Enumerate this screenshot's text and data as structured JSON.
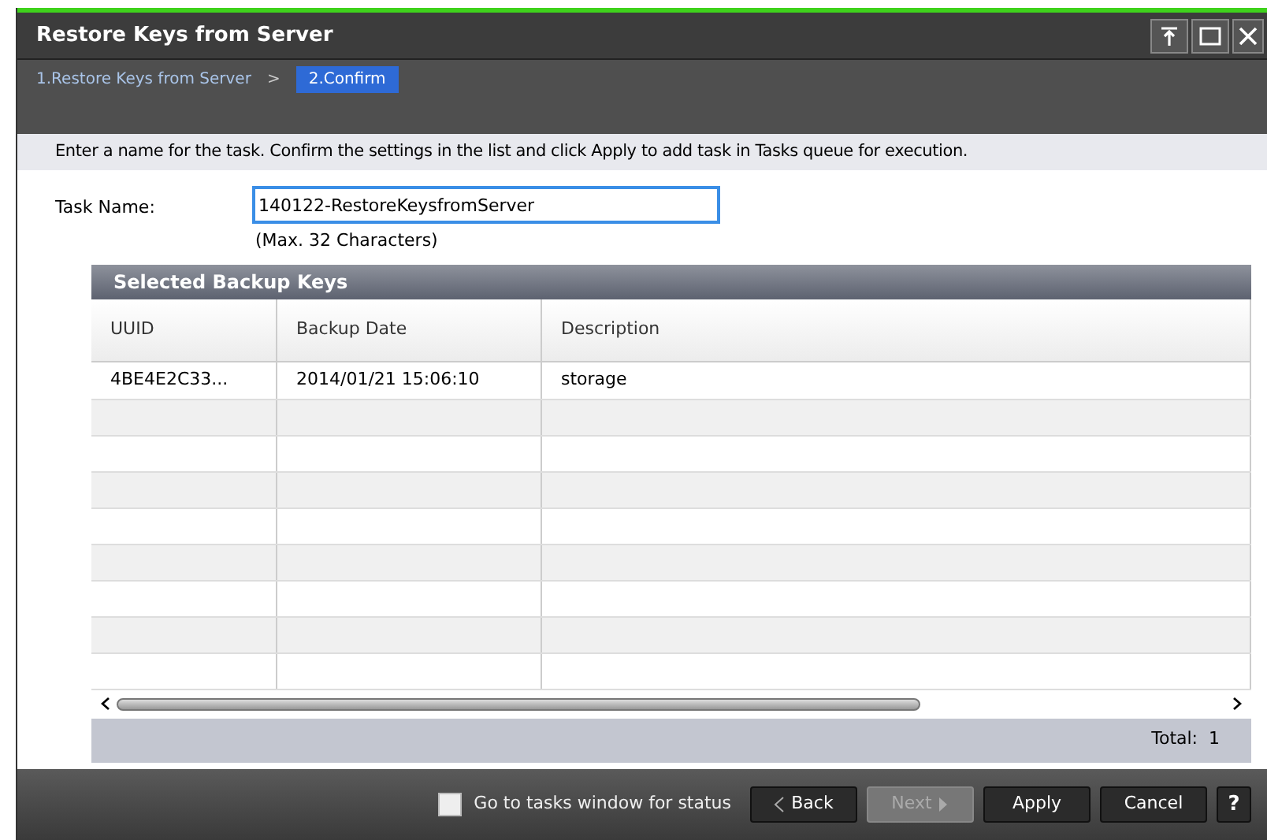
{
  "window": {
    "title": "Restore Keys from Server"
  },
  "steps": [
    {
      "label": "1.Restore Keys from Server",
      "selected": false
    },
    {
      "label": "2.Confirm",
      "selected": true
    }
  ],
  "step_separator": ">",
  "instruction": "Enter a name for the task. Confirm the settings in the list and click Apply to add task in Tasks queue for execution.",
  "task_name": {
    "label": "Task Name:",
    "value": "140122-RestoreKeysfromServer",
    "hint": "(Max. 32 Characters)"
  },
  "table": {
    "title": "Selected Backup Keys",
    "columns": [
      "UUID",
      "Backup Date",
      "Description"
    ],
    "rows": [
      [
        "4BE4E2C33...",
        "2014/01/21 15:06:10",
        "storage"
      ]
    ],
    "total": "Total:  1"
  },
  "footer": {
    "checkbox": {
      "label": "Go to tasks window for status",
      "checked": false
    },
    "buttons": [
      {
        "label": "Back",
        "kind": "back",
        "disabled": false
      },
      {
        "label": "Next",
        "kind": "next",
        "disabled": true
      },
      {
        "label": "Apply",
        "kind": "plain",
        "disabled": false
      },
      {
        "label": "Cancel",
        "kind": "plain",
        "disabled": false
      },
      {
        "label": "?",
        "kind": "help",
        "disabled": false
      }
    ]
  }
}
